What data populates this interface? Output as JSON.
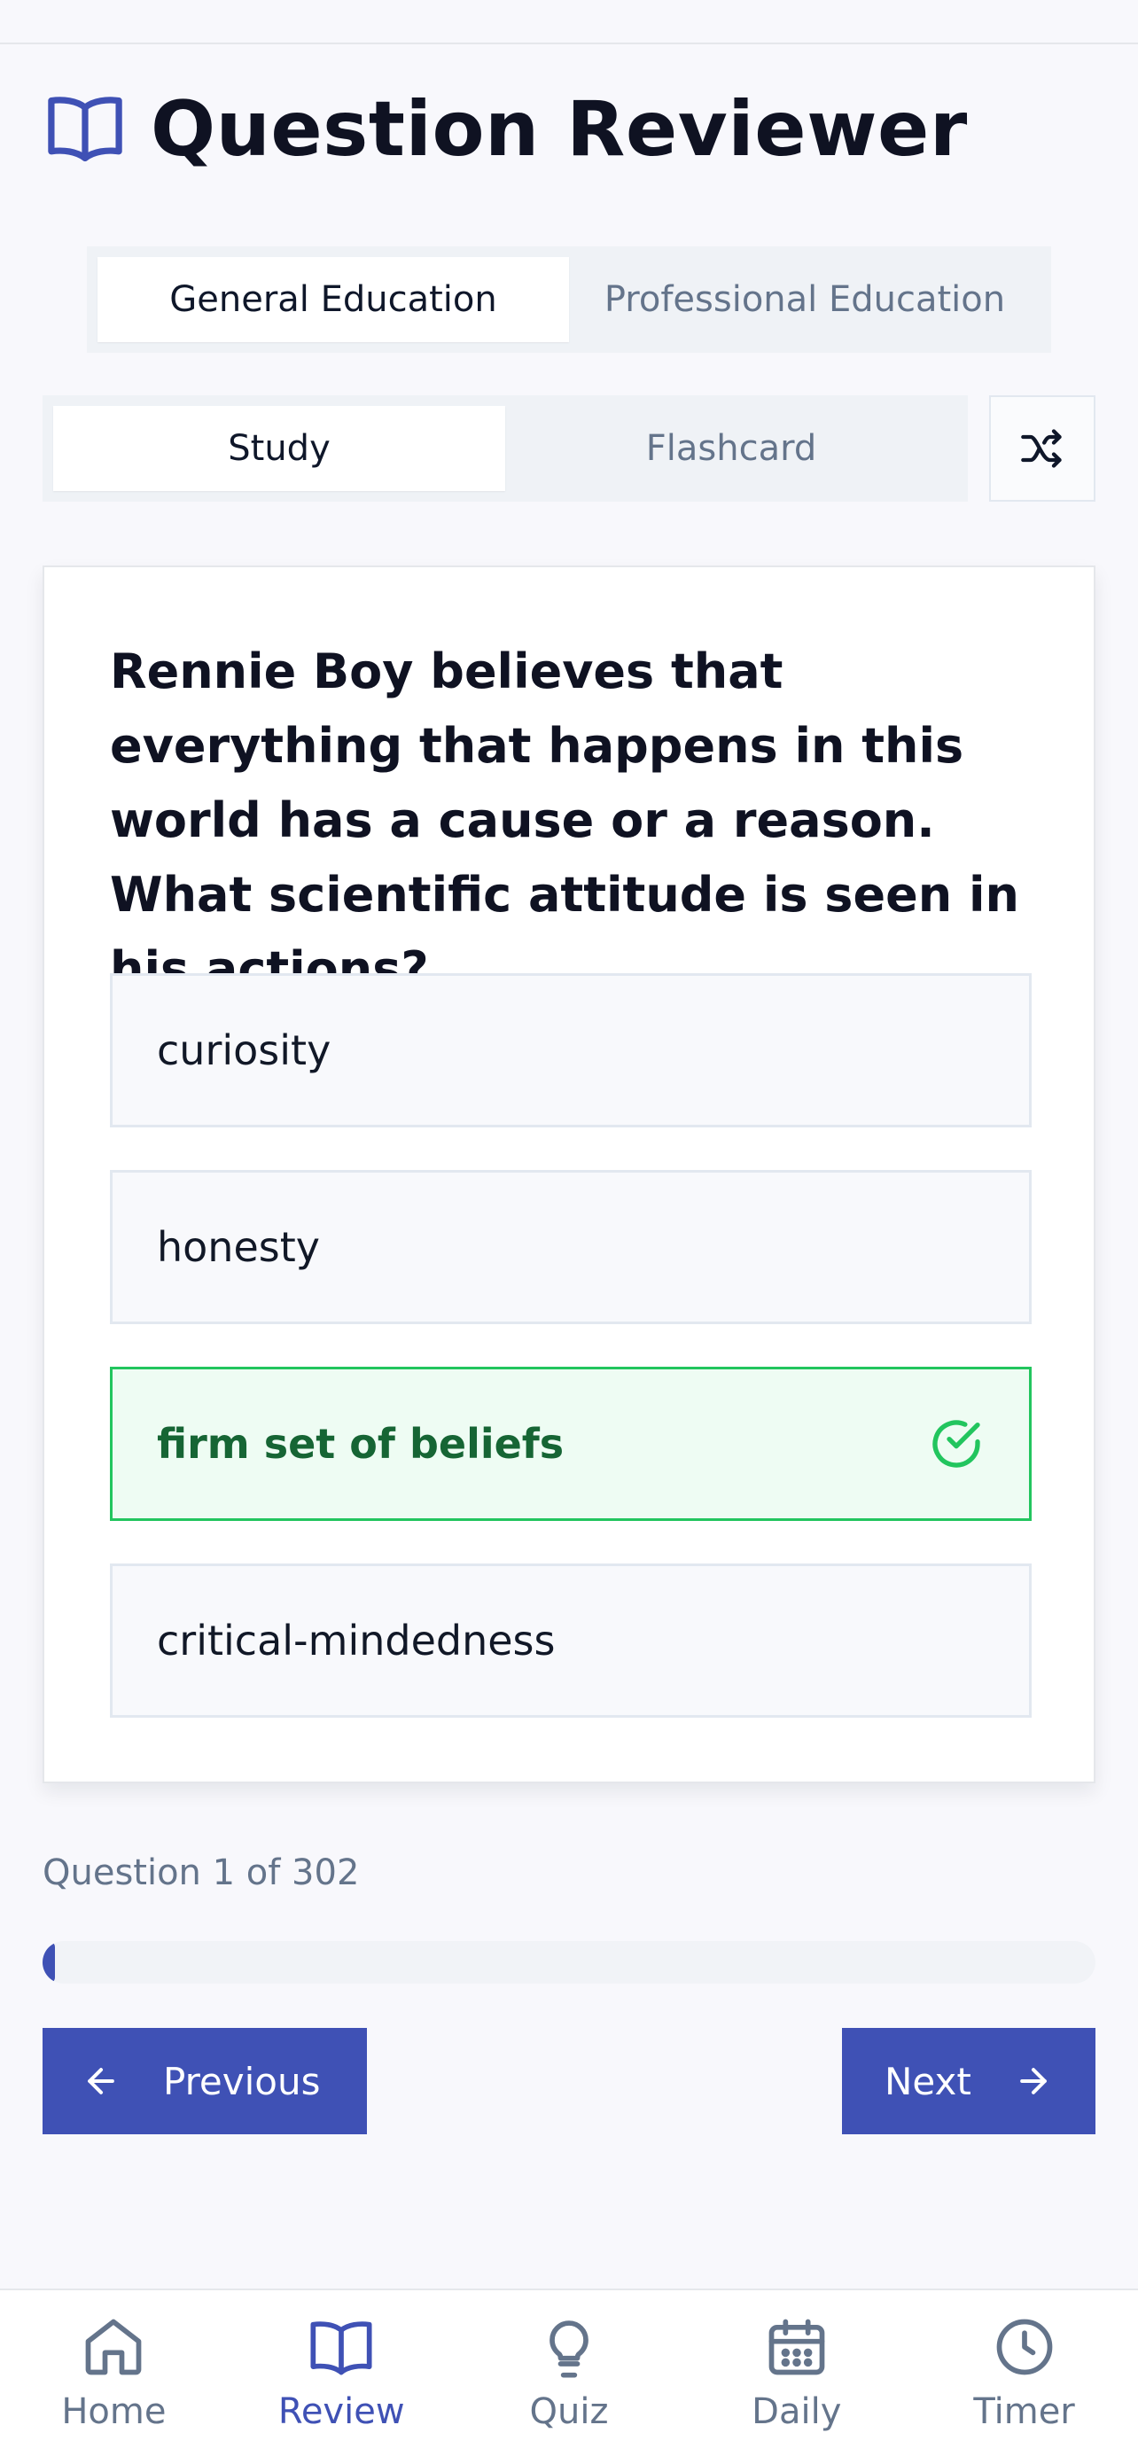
{
  "app": {
    "title": "Question Reviewer"
  },
  "subject_tabs": [
    {
      "label": "General Education",
      "active": true
    },
    {
      "label": "Professional Education",
      "active": false
    }
  ],
  "mode_tabs": [
    {
      "label": "Study",
      "active": true
    },
    {
      "label": "Flashcard",
      "active": false
    }
  ],
  "question": {
    "text": "Rennie Boy believes that everything that happens in this world has a cause or a reason. What scientific attitude is seen in his actions?",
    "options": [
      {
        "label": "curiosity",
        "correct": false
      },
      {
        "label": "honesty",
        "correct": false
      },
      {
        "label": "firm set of beliefs",
        "correct": true
      },
      {
        "label": "critical-mindedness",
        "correct": false
      }
    ]
  },
  "progress": {
    "counter_text": "Question 1 of 302",
    "current": 1,
    "total": 302
  },
  "buttons": {
    "previous": "Previous",
    "next": "Next"
  },
  "nav": [
    {
      "label": "Home",
      "icon": "home-icon",
      "active": false
    },
    {
      "label": "Review",
      "icon": "book-icon",
      "active": true
    },
    {
      "label": "Quiz",
      "icon": "lightbulb-icon",
      "active": false
    },
    {
      "label": "Daily",
      "icon": "calendar-icon",
      "active": false
    },
    {
      "label": "Timer",
      "icon": "clock-icon",
      "active": false
    }
  ],
  "colors": {
    "accent": "#3f51b5",
    "correct": "#22c55e",
    "correct_text": "#166534",
    "muted": "#64748b"
  }
}
